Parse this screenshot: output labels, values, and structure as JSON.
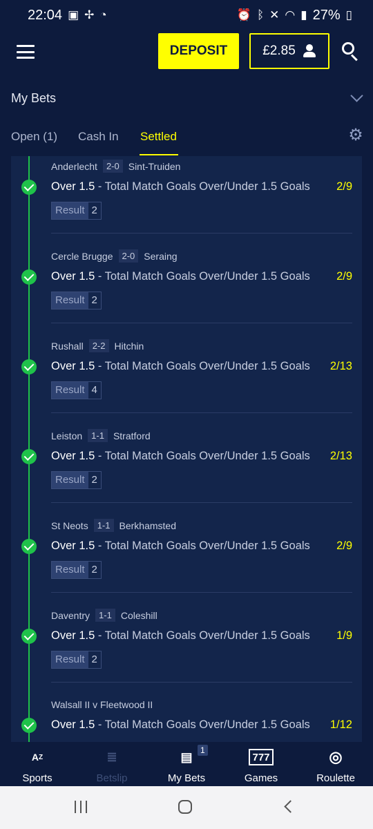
{
  "status_bar": {
    "time": "22:04",
    "battery": "27%"
  },
  "header": {
    "deposit_label": "DEPOSIT",
    "balance": "£2.85"
  },
  "my_bets": {
    "title": "My Bets"
  },
  "tabs": [
    {
      "label": "Open (1)"
    },
    {
      "label": "Cash In"
    },
    {
      "label": "Settled"
    }
  ],
  "legs": [
    {
      "home": "Anderlecht",
      "score": "2-0",
      "away": "Sint-Truiden",
      "selection": "Over 1.5",
      "market": "Total Match Goals Over/Under 1.5 Goals",
      "odds": "2/9",
      "result_label": "Result",
      "result_value": "2"
    },
    {
      "home": "Cercle Brugge",
      "score": "2-0",
      "away": "Seraing",
      "selection": "Over 1.5",
      "market": "Total Match Goals Over/Under 1.5 Goals",
      "odds": "2/9",
      "result_label": "Result",
      "result_value": "2"
    },
    {
      "home": "Rushall",
      "score": "2-2",
      "away": "Hitchin",
      "selection": "Over 1.5",
      "market": "Total Match Goals Over/Under 1.5 Goals",
      "odds": "2/13",
      "result_label": "Result",
      "result_value": "4"
    },
    {
      "home": "Leiston",
      "score": "1-1",
      "away": "Stratford",
      "selection": "Over 1.5",
      "market": "Total Match Goals Over/Under 1.5 Goals",
      "odds": "2/13",
      "result_label": "Result",
      "result_value": "2"
    },
    {
      "home": "St Neots",
      "score": "1-1",
      "away": "Berkhamsted",
      "selection": "Over 1.5",
      "market": "Total Match Goals Over/Under 1.5 Goals",
      "odds": "2/9",
      "result_label": "Result",
      "result_value": "2"
    },
    {
      "home": "Daventry",
      "score": "1-1",
      "away": "Coleshill",
      "selection": "Over 1.5",
      "market": "Total Match Goals Over/Under 1.5 Goals",
      "odds": "1/9",
      "result_label": "Result",
      "result_value": "2"
    },
    {
      "fixture": "Walsall II v Fleetwood II",
      "selection": "Over 1.5",
      "market": "Total Match Goals Over/Under 1.5 Goals",
      "odds": "1/12"
    }
  ],
  "market_separator": " - ",
  "bottom_nav": [
    {
      "label": "Sports",
      "icon": "sports-az-icon"
    },
    {
      "label": "Betslip",
      "icon": "betslip-icon"
    },
    {
      "label": "My Bets",
      "icon": "mybets-icon",
      "badge": "1"
    },
    {
      "label": "Games",
      "icon": "games-777-icon"
    },
    {
      "label": "Roulette",
      "icon": "roulette-icon"
    }
  ],
  "colors": {
    "background": "#0d1b3d",
    "panel": "#13254b",
    "accent": "#ffff00",
    "success": "#1fc24a"
  }
}
